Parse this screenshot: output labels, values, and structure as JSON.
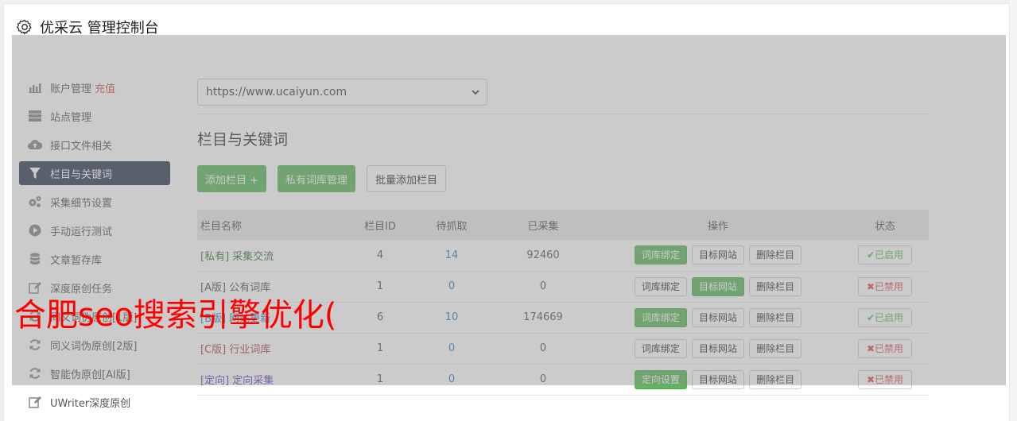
{
  "header": {
    "title": "优采云 管理控制台"
  },
  "sidebar": {
    "recharge": "充值",
    "items": [
      {
        "label": "账户管理",
        "icon": "bar-chart-icon"
      },
      {
        "label": "站点管理",
        "icon": "server-icon"
      },
      {
        "label": "接口文件相关",
        "icon": "cloud-upload-icon"
      },
      {
        "label": "栏目与关键词",
        "icon": "filter-icon"
      },
      {
        "label": "采集细节设置",
        "icon": "cogs-icon"
      },
      {
        "label": "手动运行测试",
        "icon": "play-circle-icon"
      },
      {
        "label": "文章暂存库",
        "icon": "database-icon"
      },
      {
        "label": "深度原创任务",
        "icon": "edit-icon"
      },
      {
        "label": "同义词伪原创[1版]",
        "icon": "refresh-icon"
      },
      {
        "label": "同义词伪原创[2版]",
        "icon": "refresh-icon"
      },
      {
        "label": "智能伪原创[AI版]",
        "icon": "refresh-icon"
      },
      {
        "label": "UWriter深度原创",
        "icon": "edit-icon"
      }
    ]
  },
  "main": {
    "site_select": {
      "value": "https://www.ucaiyun.com"
    },
    "section_title": "栏目与关键词",
    "buttons": {
      "add": "添加栏目 +",
      "private": "私有词库管理",
      "batch": "批量添加栏目"
    },
    "table": {
      "headers": {
        "name": "栏目名称",
        "id": "栏目ID",
        "wait": "待抓取",
        "got": "已采集",
        "op": "操作",
        "status": "状态"
      },
      "ops": {
        "bind": "词库绑定",
        "target": "目标网站",
        "delete": "删除栏目",
        "directed": "定向设置"
      },
      "rows": [
        {
          "tag": "[私有]",
          "name": "采集交流",
          "id": "4",
          "wait": "14",
          "got": "92460",
          "status": "✔已启用"
        },
        {
          "tag": "[A版]",
          "name": "公有词库",
          "id": "1",
          "wait": "0",
          "got": "0",
          "status": "✖已禁用"
        },
        {
          "tag": "[B版]",
          "name": "网站更新",
          "id": "6",
          "wait": "10",
          "got": "174669",
          "status": "✔已启用"
        },
        {
          "tag": "[C版]",
          "name": "行业词库",
          "id": "1",
          "wait": "0",
          "got": "0",
          "status": "✖已禁用"
        },
        {
          "tag": "[定向]",
          "name": "定向采集",
          "id": "1",
          "wait": "0",
          "got": "0",
          "status": "✖已禁用"
        }
      ]
    }
  },
  "watermark": "合肥seo搜索引擎优化("
}
